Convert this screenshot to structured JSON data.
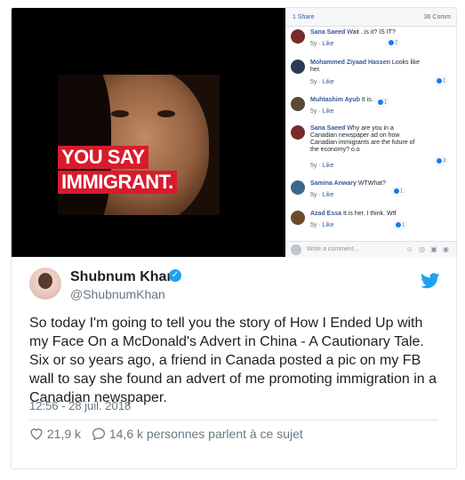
{
  "media": {
    "ad": {
      "line1": "YOU SAY",
      "line2": "IMMIGRANT."
    },
    "facebook": {
      "shares": "1 Share",
      "comments_count": "36 Comm",
      "comments": [
        {
          "name": "Sana Saeed",
          "text": "Wait ..is it? IS IT?",
          "time": "5y",
          "like": "Like",
          "reactions": "2",
          "avatar_color": "#7a2a2a"
        },
        {
          "name": "Mohammed Ziyaad Hassen",
          "text": "Looks like her.",
          "time": "5y",
          "like": "Like",
          "reactions": "1",
          "avatar_color": "#2b3b55"
        },
        {
          "name": "Muhtashim Ayub",
          "text": "It is.",
          "time": "5y",
          "like": "Like",
          "reactions": "1",
          "avatar_color": "#5a4a3a"
        },
        {
          "name": "Sana Saeed",
          "text": "Why are you in a Canadian newspaper ad on how Canadian immigrants are the future of the economy? o.o",
          "time": "5y",
          "like": "Like",
          "reactions": "3",
          "avatar_color": "#7a2a2a"
        },
        {
          "name": "Samina Anwary",
          "text": "WTWhat?",
          "time": "5y",
          "like": "Like",
          "reactions": "1",
          "avatar_color": "#3a6a8a"
        },
        {
          "name": "Azad Essa",
          "text": "It is her. I think. Wtf",
          "time": "5y",
          "like": "Like",
          "reactions": "1",
          "avatar_color": "#6a4a2a"
        }
      ],
      "write_placeholder": "Write a comment...",
      "write_icons": "☺ ◎ ▣ ◉"
    }
  },
  "tweet": {
    "name": "Shubnum Khan",
    "handle": "@ShubnumKhan",
    "verified_glyph": "✓",
    "text": "So today I'm going to tell you the story of How I Ended Up with my Face On a McDonald's Advert in China - A Cautionary Tale. Six or so years ago, a friend in Canada posted a pic on my FB wall to say she found an advert of me promoting immigration in a Canadian newspaper.",
    "timestamp": "12:56 - 28 juil. 2018",
    "likes": "21,9 k",
    "replies": "14,6 k personnes parlent à ce sujet",
    "brand_color": "#1da1f2"
  }
}
